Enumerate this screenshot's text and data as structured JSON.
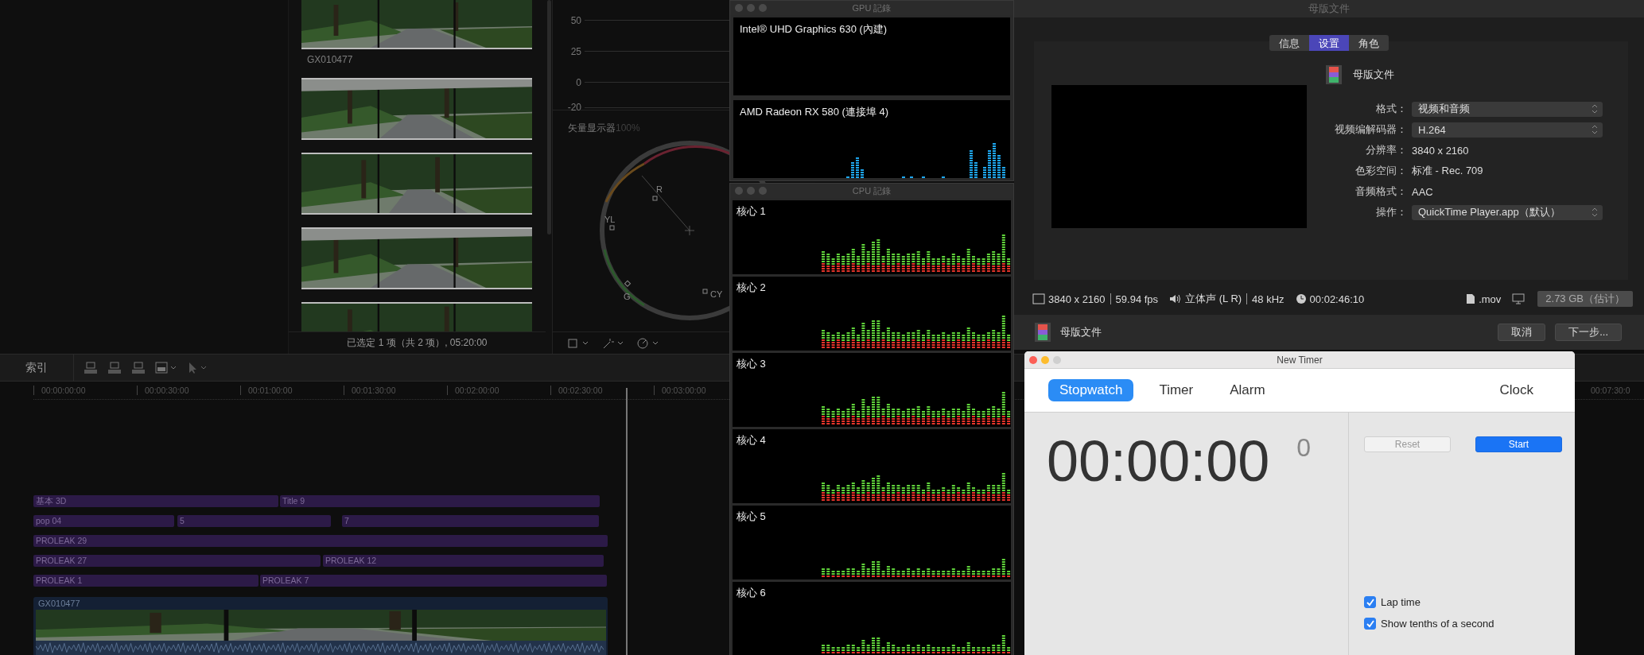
{
  "browser": {
    "clip_name": "GX010477",
    "status": "已选定 1 项（共 2 项）, 05:20:00"
  },
  "scopes": {
    "waveform_ticks": [
      "50",
      "25",
      "0",
      "-20"
    ],
    "vectorscope_title": "矢量显示器",
    "vectorscope_zoom": "100%",
    "targets": [
      "R",
      "YL",
      "G",
      "CY"
    ]
  },
  "timeline": {
    "index_tab": "索引",
    "ruler": [
      "00:00:00:00",
      "00:00:30:00",
      "00:01:00:00",
      "00:01:30:00",
      "00:02:00:00",
      "00:02:30:00",
      "00:03:00:00"
    ],
    "ruler_far": "00:07:30:0",
    "lanes": [
      {
        "clips": [
          "基本 3D",
          "Title 9"
        ]
      },
      {
        "clips": [
          "pop 04",
          "5",
          "7"
        ]
      },
      {
        "clips": [
          "PROLEAK 29"
        ]
      },
      {
        "clips": [
          "PROLEAK 27",
          "PROLEAK 12"
        ]
      },
      {
        "clips": [
          "PROLEAK 1",
          "PROLEAK 7"
        ]
      }
    ],
    "primary_clip": {
      "label": "GX010477",
      "kind": "picture"
    }
  },
  "gpu_window": {
    "title": "GPU 記錄",
    "gpus": [
      {
        "name": "Intel® UHD Graphics 630 (內建)",
        "busy": false
      },
      {
        "name": "AMD Radeon RX 580 (連接埠 4)",
        "busy": true
      }
    ]
  },
  "cpu_window": {
    "title": "CPU 記錄",
    "cores": [
      "核心 1",
      "核心 2",
      "核心 3",
      "核心 4",
      "核心 5",
      "核心 6"
    ]
  },
  "export_dialog": {
    "title": "母版文件",
    "tabs": [
      {
        "label": "信息",
        "selected": false
      },
      {
        "label": "设置",
        "selected": true
      },
      {
        "label": "角色",
        "selected": false
      }
    ],
    "heading": "母版文件",
    "fields": [
      {
        "label": "格式：",
        "value": "视频和音频",
        "kind": "popup"
      },
      {
        "label": "视频编解码器：",
        "value": "H.264",
        "kind": "popup"
      },
      {
        "label": "分辨率：",
        "value": "3840 x 2160",
        "kind": "text"
      },
      {
        "label": "色彩空间：",
        "value": "标准 - Rec. 709",
        "kind": "text"
      },
      {
        "label": "音频格式：",
        "value": "AAC",
        "kind": "text"
      },
      {
        "label": "操作：",
        "value": "QuickTime Player.app（默认）",
        "kind": "popup"
      }
    ],
    "status": {
      "resolution": "3840 x 2160",
      "frame_rate": "59.94 fps",
      "audio": "立体声 (L R)",
      "sample_rate": "48 kHz",
      "duration": "00:02:46:10",
      "extension": ".mov",
      "size": "2.73 GB（估计）"
    },
    "footer_title": "母版文件",
    "buttons": [
      "取消",
      "下一步..."
    ]
  },
  "timer_window": {
    "title": "New Timer",
    "tabs": [
      {
        "label": "Stopwatch",
        "selected": true
      },
      {
        "label": "Timer",
        "selected": false
      },
      {
        "label": "Alarm",
        "selected": false
      },
      {
        "label": "Clock",
        "selected": false
      }
    ],
    "time": "00:00:00",
    "tenths": "0",
    "buttons": [
      {
        "label": "Reset",
        "kind": "secondary",
        "disabled": true
      },
      {
        "label": "Start",
        "kind": "primary",
        "disabled": false
      }
    ],
    "options": [
      {
        "label": "Lap time",
        "checked": true
      },
      {
        "label": "Show tenths of a second",
        "checked": true
      }
    ]
  }
}
